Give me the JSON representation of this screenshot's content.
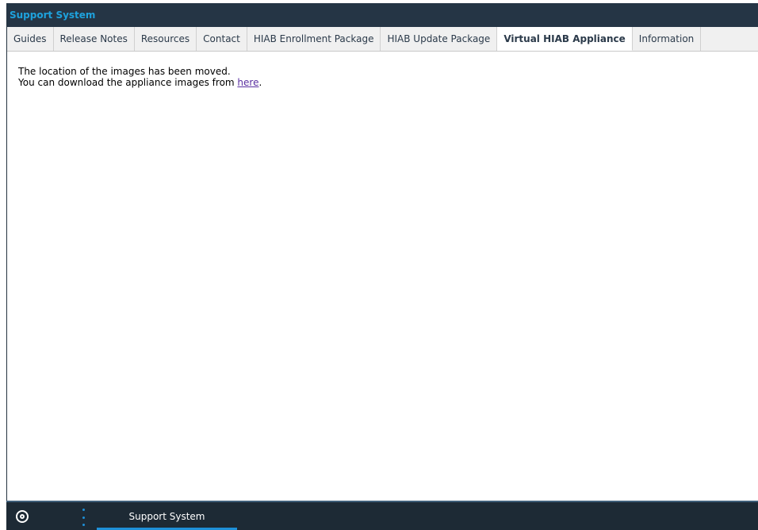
{
  "window": {
    "title": "Support System"
  },
  "tabs": [
    {
      "label": "Guides",
      "active": false
    },
    {
      "label": "Release Notes",
      "active": false
    },
    {
      "label": "Resources",
      "active": false
    },
    {
      "label": "Contact",
      "active": false
    },
    {
      "label": "HIAB Enrollment Package",
      "active": false
    },
    {
      "label": "HIAB Update Package",
      "active": false
    },
    {
      "label": "Virtual HIAB Appliance",
      "active": true
    },
    {
      "label": "Information",
      "active": false
    }
  ],
  "content": {
    "line1": "The location of the images has been moved.",
    "line2_prefix": "You can download the appliance images from ",
    "link_text": "here",
    "line2_suffix": "."
  },
  "taskbar": {
    "start_icon": "target-icon",
    "menu_icon": "vertical-dots-icon",
    "task_label": "Support System",
    "accent_color": "#1e90d8"
  },
  "colors": {
    "titlebar": "#253545",
    "title_text": "#1ea2dd",
    "link": "#5a2fa0"
  }
}
